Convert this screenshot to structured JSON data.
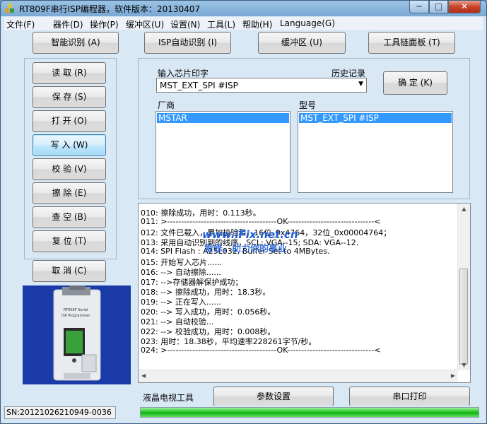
{
  "window": {
    "title": "RT809F串行ISP编程器，软件版本：20130407",
    "min_glyph": "─",
    "max_glyph": "□",
    "close_glyph": "✕"
  },
  "menu": [
    "文件(F)",
    "器件(D)",
    "操作(P)",
    "缓冲区(U)",
    "设置(N)",
    "工具(L)",
    "帮助(H)",
    "Language(G)"
  ],
  "toolbar": {
    "smart_detect": "智能识别 (A)",
    "isp_auto_detect": "ISP自动识别 (I)",
    "buffer": "缓冲区 (U)",
    "tool_panel": "工具链面板 (T)"
  },
  "side_buttons": {
    "read": "读 取 (R)",
    "save": "保 存 (S)",
    "open": "打 开 (O)",
    "write": "写 入 (W)",
    "verify": "校 验 (V)",
    "erase": "擦 除 (E)",
    "blank_check": "查 空 (B)",
    "reset": "复 位 (T)",
    "cancel": "取 消 (C)"
  },
  "chip": {
    "input_label": "输入芯片印字",
    "history_label": "历史记录",
    "input_value": "MST_EXT_SPI #ISP",
    "confirm_button": "确 定 (K)",
    "vendor_label": "厂商",
    "vendor_selected": "MSTAR",
    "model_label": "型号",
    "model_selected": "MST_EXT_SPI #ISP"
  },
  "device_image": {
    "label1": "RT809F Serial",
    "label2": "ISP Programmer"
  },
  "log_lines": [
    "010: 擦除成功，用时：0.113秒。",
    "011: >---------------------------------------OK-------------------------------<",
    "012: 文件已载入，累加校验和：16位_0x4764，32位_0x00004764；",
    "013: 采用自动识别到的线序，SCL: VGA--15; SDA: VGA--12.",
    "014: SPI Flash : A25L032, Buffer Set to 4MBytes.",
    "015: 开始写入芯片......",
    "016: --> 自动擦除......",
    "017: -->存储器解保护成功；",
    "018: --> 擦除成功，用时：18.3秒。",
    "019: --> 正在写入......",
    "020: --> 写入成功，用时：0.056秒。",
    "021: --> 自动校验...",
    "022: --> 校验成功，用时：0.008秒。",
    "023: 用时：18.38秒，平均速率228261字节/秒。",
    "024: >---------------------------------------OK-------------------------------<"
  ],
  "watermark": {
    "url": "www.iFix.net.cn",
    "slogan": "爱修，助力你的事业"
  },
  "bottom": {
    "lcd_tools": "液晶电视工具",
    "param_settings": "参数设置",
    "serial_print": "串口打印"
  },
  "status": {
    "sn": "SN:20121026210949-0036",
    "progress": 1.0
  },
  "colors": {
    "selection": "#3399ff",
    "progress": "#22c622",
    "client_bg": "#d9e8f5"
  }
}
